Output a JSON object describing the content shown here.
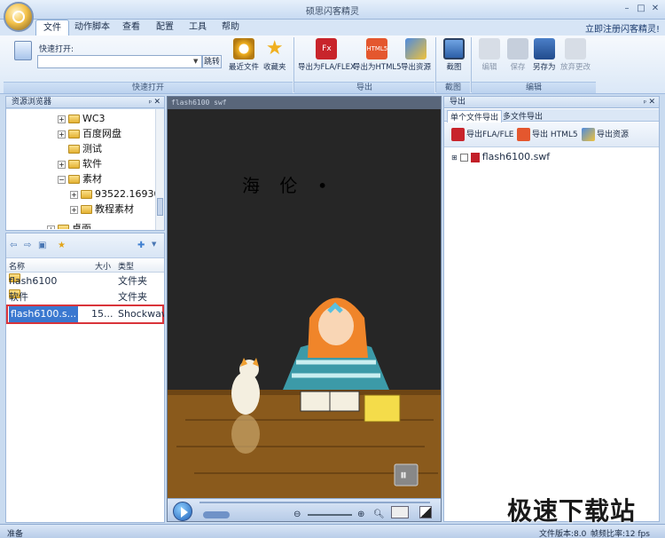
{
  "window": {
    "title": "硕思闪客精灵",
    "register_link": "立即注册闪客精灵!",
    "min": "–",
    "max": "□",
    "close": "✕"
  },
  "menu": [
    "文件",
    "动作脚本",
    "查看",
    "配置",
    "工具",
    "帮助"
  ],
  "ribbon": {
    "quick_open_label": "快速打开:",
    "quick_open_value": "",
    "jump_label": "跳转",
    "recent_label": "最近文件",
    "favorites_label": "收藏夹",
    "group_quick_open": "快速打开",
    "export_fla_label": "导出为FLA/FLEX",
    "export_html5_label": "导出为HTML5",
    "export_res_label": "导出资源",
    "group_export": "导出",
    "screenshot_label": "截图",
    "group_screenshot": "截图",
    "edit_label": "编辑",
    "save_label": "保存",
    "save_as_label": "另存为",
    "discard_label": "放弃更改",
    "group_edit": "编辑",
    "icon_fla_text": "Fx",
    "icon_html5_text": "HTML5"
  },
  "resource_browser": {
    "title": "资源浏览器",
    "tree": [
      {
        "label": "WC3",
        "expander": "+"
      },
      {
        "label": "百度网盘",
        "expander": "+"
      },
      {
        "label": "测试",
        "expander": ""
      },
      {
        "label": "软件",
        "expander": "+"
      },
      {
        "label": "素材",
        "expander": "−"
      },
      {
        "label": "93522.16930",
        "expander": "+"
      },
      {
        "label": "教程素材",
        "expander": "+"
      },
      {
        "label": "桌面",
        "expander": "+"
      }
    ]
  },
  "file_list": {
    "columns": [
      "名称",
      "大小",
      "类型"
    ],
    "rows": [
      {
        "name": "flash6100",
        "size": "",
        "type": "文件夹"
      },
      {
        "name": "软件",
        "size": "",
        "type": "文件夹"
      },
      {
        "name": "flash6100.s...",
        "size": "15...",
        "type": "Shockwave"
      }
    ]
  },
  "player": {
    "tab_title": "flash6100 swf",
    "stage_text": "海 伦 •",
    "pause_icon": "⏸"
  },
  "export_panel": {
    "title": "导出",
    "tabs": [
      "单个文件导出",
      "多文件导出"
    ],
    "toolbar": [
      "导出FLA/FLE",
      "导出 HTML5",
      "导出资源"
    ],
    "item": "flash6100.swf"
  },
  "status": {
    "left": "准备",
    "version": "文件版本:8.0",
    "fps": "帧频比率:12 fps"
  },
  "watermark": "极速下载站",
  "colors": {
    "accent": "#3a78d0",
    "selection_border": "#d9343a",
    "panel_border": "#9fb8da"
  }
}
